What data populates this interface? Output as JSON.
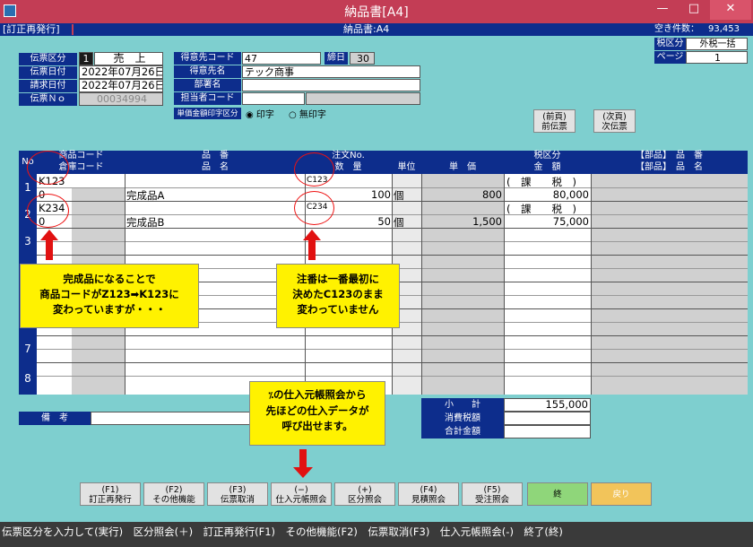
{
  "window": {
    "title": "納品書[A4]",
    "minimize": "—",
    "maximize": "□",
    "close": "✕"
  },
  "info": {
    "mode": "[訂正再発行]",
    "form": "納品書:A4",
    "empty_label": "空き件数：",
    "empty_count": "93,453"
  },
  "tax": {
    "label": "税区分",
    "value": "外税一括",
    "page_label": "ページ",
    "page_value": "1"
  },
  "header": {
    "denpyo_kubun_label": "伝票区分",
    "denpyo_kubun_code": "1",
    "denpyo_kubun_value": "売　上",
    "denpyo_date_label": "伝票日付",
    "denpyo_date": "2022年07月26日",
    "seikyu_date_label": "請求日付",
    "seikyu_date": "2022年07月26日",
    "denpyo_no_label": "伝票Ｎｏ",
    "denpyo_no": "00034994",
    "customer_code_label": "得意先コード",
    "customer_code": "47",
    "shime_label": "締日",
    "shime_value": "30",
    "customer_name_label": "得意先名",
    "customer_name": "テック商事",
    "dept_label": "部署名",
    "dept_value": "",
    "staff_label": "担当者コード",
    "staff_code": "",
    "staff_name": "",
    "price_print_label": "単価金額印字区分",
    "print_option": "印字",
    "noprint_option": "無印字"
  },
  "nav": {
    "prev": [
      "(前頁)",
      "前伝票"
    ],
    "next": [
      "(次頁)",
      "次伝票"
    ]
  },
  "grid": {
    "no_label": "No",
    "h_product_code": "商品コード",
    "h_warehouse": "倉庫コード",
    "h_hinban": "品　番",
    "h_hinmei": "品　名",
    "h_order_no": "注文No.",
    "h_qty": "数　量",
    "h_unit": "単位",
    "h_price": "単　価",
    "h_tax_kubun": "税区分",
    "h_amount": "金　額",
    "h_part1": "【部品】　品　番",
    "h_part2": "【部品】　品　名",
    "rows": [
      {
        "no": "1",
        "code": "K123",
        "warehouse": "0",
        "name": "完成品A",
        "order_no": "C123",
        "qty": "100",
        "unit": "個",
        "price": "800",
        "tax": "(　課　　税　)",
        "amount": "80,000"
      },
      {
        "no": "2",
        "code": "K234",
        "warehouse": "0",
        "name": "完成品B",
        "order_no": "C234",
        "qty": "50",
        "unit": "個",
        "price": "1,500",
        "tax": "(　課　　税　)",
        "amount": "75,000"
      },
      {
        "no": "3"
      },
      {
        "no": "4"
      },
      {
        "no": "5"
      },
      {
        "no": "6"
      },
      {
        "no": "7"
      },
      {
        "no": "8"
      }
    ]
  },
  "totals": {
    "subtotal_label": "小　　計",
    "subtotal": "155,000",
    "tax_label": "消費税額",
    "tax": "",
    "total_label": "合計金額",
    "total": ""
  },
  "remarks": {
    "label": "備　考",
    "value": ""
  },
  "callouts": {
    "c1": [
      "完成品になることで",
      "商品コードがZ123➡K123に",
      "変わっていますが・・・"
    ],
    "c2": [
      "注番は一番最初に",
      "決めたC123のまま",
      "変わっていません"
    ],
    "c3": [
      "の仕入元帳照会から",
      "先ほどの仕入データが",
      "呼び出せます。"
    ]
  },
  "fkeys": [
    {
      "key": "(F1)",
      "label": "訂正再発行"
    },
    {
      "key": "(F2)",
      "label": "その他機能"
    },
    {
      "key": "(F3)",
      "label": "伝票取消"
    },
    {
      "key": "(−)",
      "label": "仕入元帳照会"
    },
    {
      "key": "(+)",
      "label": "区分照会"
    },
    {
      "key": "(F4)",
      "label": "見積照会"
    },
    {
      "key": "(F5)",
      "label": "受注照会"
    }
  ],
  "end_button": "終",
  "back_button": "戻り",
  "status": "伝票区分を入力して(実行)　区分照会(＋)　訂正再発行(F1)　その他機能(F2)　伝票取消(F3)　仕入元帳照会(-)　終了(終)",
  "colors": {
    "titlebar": "#c33d55",
    "background": "#7ecfcf",
    "navy": "#0d2d8c",
    "callout": "#fff200",
    "arrow": "#e11111"
  }
}
